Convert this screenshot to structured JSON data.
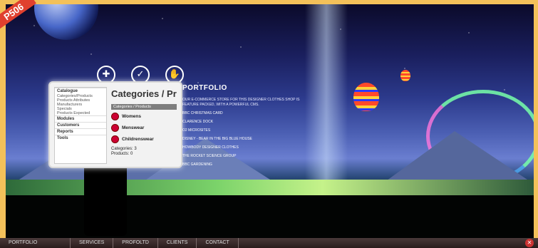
{
  "corner_label": "P506",
  "cms": {
    "title": "Categories / Pr",
    "bar": "Categories / Products",
    "nav": [
      {
        "label": "Catalogue",
        "bold": true
      },
      {
        "label": "Categories/Products",
        "bold": false
      },
      {
        "label": "Products Attributes",
        "bold": false
      },
      {
        "label": "Manufacturers",
        "bold": false
      },
      {
        "label": "Specials",
        "bold": false
      },
      {
        "label": "Products Expected",
        "bold": false
      },
      {
        "label": "Modules",
        "bold": true
      },
      {
        "label": "Customers",
        "bold": true
      },
      {
        "label": "Reports",
        "bold": true
      },
      {
        "label": "Tools",
        "bold": true
      }
    ],
    "categories": [
      "Womens",
      "Menswear",
      "Childrenswear"
    ],
    "stats": {
      "categories": "Categories: 3",
      "products": "Products: 0"
    }
  },
  "portfolio": {
    "title": "PORTFOLIO",
    "description": "OUR E-COMMERCE STORE FOR THIS DESIGNER CLOTHES SHOP IS FEATURE PACKED, WITH A POWERFUL CMS.",
    "links": [
      "BBC CHRISTMAS CARD",
      "CLARENCE DOCK",
      "O2 MICROSITES",
      "DISNEY - BEAR IN THE BIG BLUE HOUSE",
      "HOWBODY DESIGNER CLOTHES",
      "THE ROCKET SCIENCE GROUP",
      "BBC GARDENING"
    ]
  },
  "nav": {
    "items": [
      "PORTFOLIO",
      "SERVICES",
      "PROFOLTD",
      "CLIENTS",
      "CONTACT"
    ]
  }
}
